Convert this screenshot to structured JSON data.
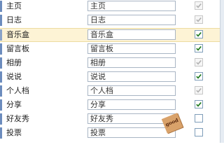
{
  "rows": [
    {
      "label": "主页",
      "value": "主页",
      "checked": true,
      "enabled": false,
      "highlight": false
    },
    {
      "label": "日志",
      "value": "日志",
      "checked": true,
      "enabled": false,
      "highlight": false
    },
    {
      "label": "音乐盒",
      "value": "音乐盒",
      "checked": true,
      "enabled": true,
      "highlight": true
    },
    {
      "label": "留言板",
      "value": "留言板",
      "checked": true,
      "enabled": true,
      "highlight": false
    },
    {
      "label": "相册",
      "value": "相册",
      "checked": true,
      "enabled": false,
      "highlight": false
    },
    {
      "label": "说说",
      "value": "说说",
      "checked": true,
      "enabled": true,
      "highlight": false
    },
    {
      "label": "个人档",
      "value": "个人档",
      "checked": true,
      "enabled": false,
      "highlight": false
    },
    {
      "label": "分享",
      "value": "分享",
      "checked": true,
      "enabled": true,
      "highlight": false
    },
    {
      "label": "好友秀",
      "value": "好友秀",
      "checked": false,
      "enabled": true,
      "highlight": false
    },
    {
      "label": "投票",
      "value": "投票",
      "checked": false,
      "enabled": true,
      "highlight": false
    }
  ],
  "badge_text": "good",
  "colors": {
    "check_enabled": "#1f7a1f",
    "check_disabled": "#b4b4b4",
    "highlight_row": "#fdf3d5"
  }
}
